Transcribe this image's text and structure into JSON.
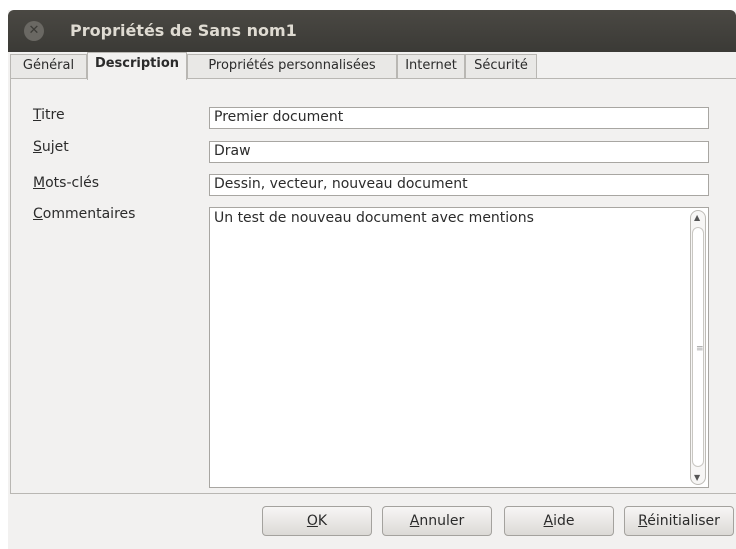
{
  "window": {
    "title": "Propriétés de Sans nom1"
  },
  "tabs": [
    {
      "label": "Général"
    },
    {
      "label": "Description"
    },
    {
      "label": "Propriétés personnalisées"
    },
    {
      "label": "Internet"
    },
    {
      "label": "Sécurité"
    }
  ],
  "active_tab": "Description",
  "fields": {
    "title": {
      "label_first": "T",
      "label_rest": "itre",
      "value": "Premier document"
    },
    "subject": {
      "label_first": "S",
      "label_rest": "ujet",
      "value": "Draw"
    },
    "keywords": {
      "label_first": "M",
      "label_rest": "ots-clés",
      "value": "Dessin, vecteur, nouveau document"
    },
    "comments": {
      "label_first": "C",
      "label_rest": "ommentaires",
      "value": "Un test de nouveau document avec mentions"
    }
  },
  "buttons": {
    "ok": {
      "label_first": "O",
      "label_rest": "K"
    },
    "cancel": {
      "label_first": "A",
      "label_rest": "nnuler"
    },
    "help": {
      "label_first": "A",
      "label_rest": "ide"
    },
    "reset": {
      "label_first": "R",
      "label_rest": "éinitialiser"
    }
  },
  "colors": {
    "titlebar": "#3b3a36",
    "background": "#f2f1f0"
  }
}
